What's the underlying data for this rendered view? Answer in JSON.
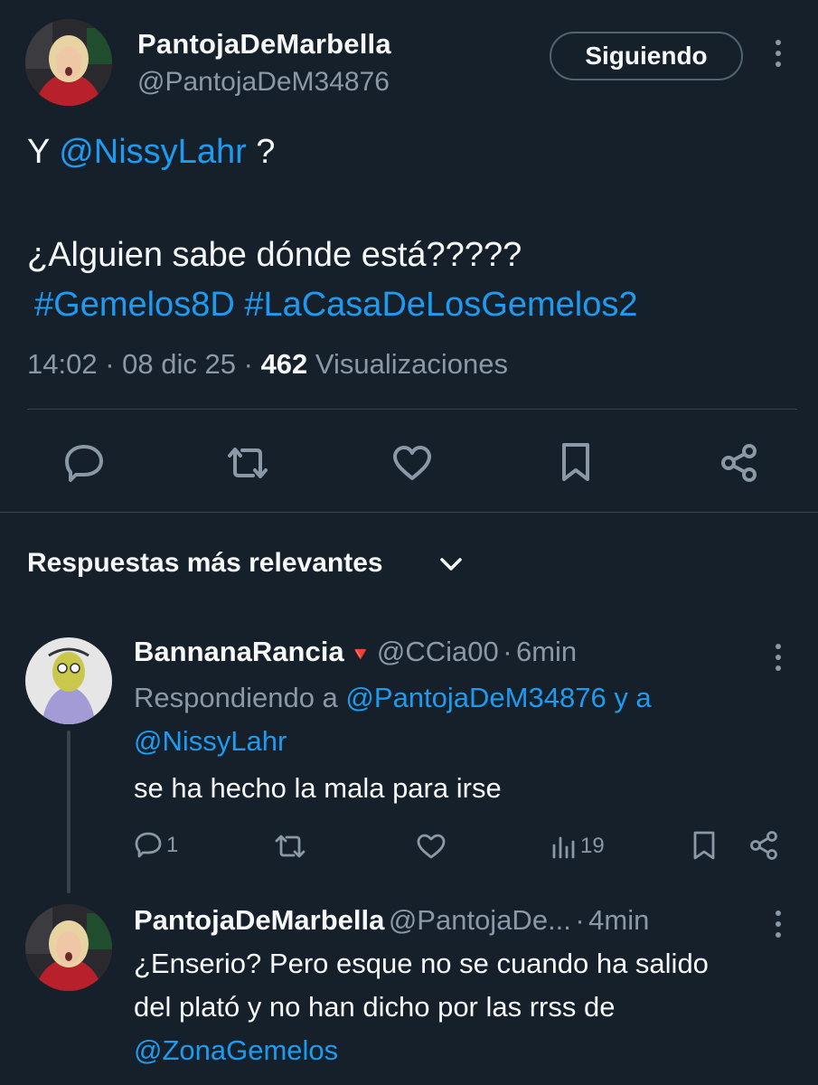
{
  "tweet": {
    "author_name": "PantojaDeMarbella",
    "author_handle": "@PantojaDeM34876",
    "follow_label": "Siguiendo",
    "line1_prefix": "Y ",
    "line1_mention": "@NissyLahr",
    "line1_suffix": " ?",
    "line2": "¿Alguien sabe dónde está?????",
    "hashtag1": "#Gemelos8D",
    "hashtag2": "#LaCasaDeLosGemelos2",
    "time": "14:02",
    "date": "08 dic 25",
    "views_count": "462",
    "views_label": "Visualizaciones"
  },
  "replies_header": {
    "title": "Respuestas más relevantes"
  },
  "replies": [
    {
      "author_name": "BannanaRancia",
      "badge": "🔻",
      "author_handle": "@CCia00",
      "time": "6min",
      "replying_prefix": "Respondiendo a",
      "replying_to_1": "@PantojaDeM34876",
      "replying_joiner": "y a",
      "replying_to_2": "@NissyLahr",
      "text": "se ha hecho la mala para irse",
      "reply_count": "1",
      "views": "19"
    },
    {
      "author_name": "PantojaDeMarbella",
      "author_handle": "@PantojaDe...",
      "time": "4min",
      "text_line1": "¿Enserio? Pero esque no se cuando ha salido",
      "text_line2": "del plató y no han dicho por las rrss de",
      "mention": "@ZonaGemelos"
    }
  ],
  "colors": {
    "background": "#15202b",
    "accent": "#1d9bf0",
    "secondary_text": "#8b98a5",
    "divider": "#38444d"
  }
}
